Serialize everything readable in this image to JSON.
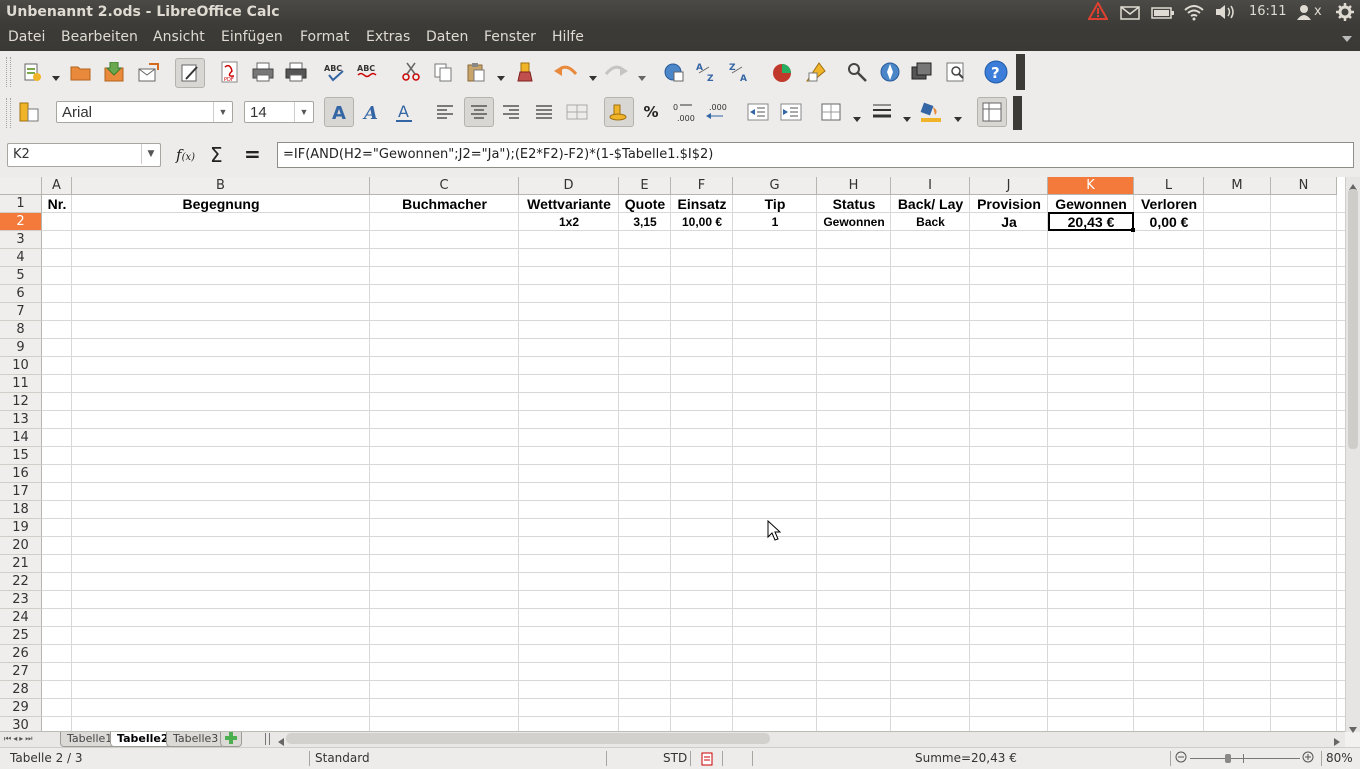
{
  "window": {
    "title": "Unbenannt 2.ods - LibreOffice Calc"
  },
  "tray": {
    "time": "16:11",
    "user_suffix": "x"
  },
  "menu": [
    "Datei",
    "Bearbeiten",
    "Ansicht",
    "Einfügen",
    "Format",
    "Extras",
    "Daten",
    "Fenster",
    "Hilfe"
  ],
  "format_toolbar": {
    "font_name": "Arial",
    "font_size": "14",
    "percent_label": "%"
  },
  "formula_bar": {
    "name_box": "K2",
    "formula": "=IF(AND(H2=\"Gewonnen\";J2=\"Ja\");(E2*F2)-F2)*(1-$Tabelle1.$I$2)"
  },
  "grid": {
    "columns": [
      "A",
      "B",
      "C",
      "D",
      "E",
      "F",
      "G",
      "H",
      "I",
      "J",
      "K",
      "L",
      "M",
      "N"
    ],
    "selected_column": "K",
    "rows": [
      "1",
      "2",
      "3",
      "4",
      "5",
      "6",
      "7",
      "8",
      "9",
      "10",
      "11",
      "12",
      "13",
      "14",
      "15",
      "16",
      "17",
      "18",
      "19",
      "20",
      "21",
      "22",
      "23",
      "24",
      "25",
      "26",
      "27",
      "28",
      "29",
      "30"
    ],
    "selected_row": "2",
    "header_row": [
      "Nr.",
      "Begegnung",
      "Buchmacher",
      "Wettvariante",
      "Quote",
      "Einsatz",
      "Tip",
      "Status",
      "Back/ Lay",
      "Provision",
      "Gewonnen",
      "Verloren",
      "",
      ""
    ],
    "data_row": [
      "",
      "",
      "",
      "1x2",
      "3,15",
      "10,00 €",
      "1",
      "Gewonnen",
      "Back",
      "Ja",
      "20,43 €",
      "0,00 €",
      "",
      ""
    ]
  },
  "sheet_tabs": {
    "tabs": [
      "Tabelle1",
      "Tabelle2",
      "Tabelle3"
    ],
    "active": "Tabelle2"
  },
  "status_bar": {
    "sheet": "Tabelle 2 / 3",
    "style": "Standard",
    "mode": "STD",
    "sum": "Summe=20,43 €",
    "zoom": "80%"
  },
  "colors": {
    "accent_selected": "#f47a3c",
    "titlebar": "#3c3b37"
  }
}
